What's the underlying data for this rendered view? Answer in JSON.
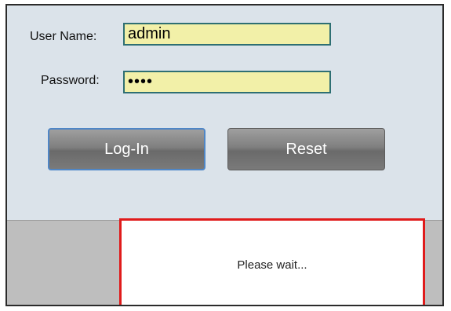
{
  "login": {
    "username_label": "User Name:",
    "username_value": "admin",
    "password_label": "Password:",
    "password_value": "••••",
    "login_button": "Log-In",
    "reset_button": "Reset"
  },
  "status": {
    "message": "Please wait..."
  },
  "colors": {
    "field_background": "#f2f0a8",
    "field_border": "#2e6f73",
    "panel_background": "#dbe3ea",
    "wait_border": "#e01b1b"
  }
}
